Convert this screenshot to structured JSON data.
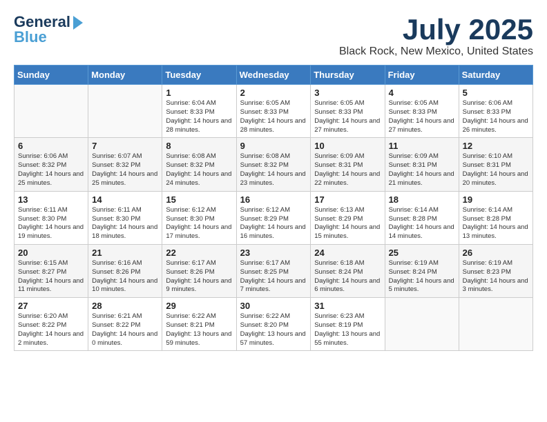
{
  "header": {
    "logo_line1": "General",
    "logo_line2": "Blue",
    "month_title": "July 2025",
    "location": "Black Rock, New Mexico, United States"
  },
  "weekdays": [
    "Sunday",
    "Monday",
    "Tuesday",
    "Wednesday",
    "Thursday",
    "Friday",
    "Saturday"
  ],
  "weeks": [
    [
      {
        "day": "",
        "info": ""
      },
      {
        "day": "",
        "info": ""
      },
      {
        "day": "1",
        "info": "Sunrise: 6:04 AM\nSunset: 8:33 PM\nDaylight: 14 hours and 28 minutes."
      },
      {
        "day": "2",
        "info": "Sunrise: 6:05 AM\nSunset: 8:33 PM\nDaylight: 14 hours and 28 minutes."
      },
      {
        "day": "3",
        "info": "Sunrise: 6:05 AM\nSunset: 8:33 PM\nDaylight: 14 hours and 27 minutes."
      },
      {
        "day": "4",
        "info": "Sunrise: 6:05 AM\nSunset: 8:33 PM\nDaylight: 14 hours and 27 minutes."
      },
      {
        "day": "5",
        "info": "Sunrise: 6:06 AM\nSunset: 8:33 PM\nDaylight: 14 hours and 26 minutes."
      }
    ],
    [
      {
        "day": "6",
        "info": "Sunrise: 6:06 AM\nSunset: 8:32 PM\nDaylight: 14 hours and 25 minutes."
      },
      {
        "day": "7",
        "info": "Sunrise: 6:07 AM\nSunset: 8:32 PM\nDaylight: 14 hours and 25 minutes."
      },
      {
        "day": "8",
        "info": "Sunrise: 6:08 AM\nSunset: 8:32 PM\nDaylight: 14 hours and 24 minutes."
      },
      {
        "day": "9",
        "info": "Sunrise: 6:08 AM\nSunset: 8:32 PM\nDaylight: 14 hours and 23 minutes."
      },
      {
        "day": "10",
        "info": "Sunrise: 6:09 AM\nSunset: 8:31 PM\nDaylight: 14 hours and 22 minutes."
      },
      {
        "day": "11",
        "info": "Sunrise: 6:09 AM\nSunset: 8:31 PM\nDaylight: 14 hours and 21 minutes."
      },
      {
        "day": "12",
        "info": "Sunrise: 6:10 AM\nSunset: 8:31 PM\nDaylight: 14 hours and 20 minutes."
      }
    ],
    [
      {
        "day": "13",
        "info": "Sunrise: 6:11 AM\nSunset: 8:30 PM\nDaylight: 14 hours and 19 minutes."
      },
      {
        "day": "14",
        "info": "Sunrise: 6:11 AM\nSunset: 8:30 PM\nDaylight: 14 hours and 18 minutes."
      },
      {
        "day": "15",
        "info": "Sunrise: 6:12 AM\nSunset: 8:30 PM\nDaylight: 14 hours and 17 minutes."
      },
      {
        "day": "16",
        "info": "Sunrise: 6:12 AM\nSunset: 8:29 PM\nDaylight: 14 hours and 16 minutes."
      },
      {
        "day": "17",
        "info": "Sunrise: 6:13 AM\nSunset: 8:29 PM\nDaylight: 14 hours and 15 minutes."
      },
      {
        "day": "18",
        "info": "Sunrise: 6:14 AM\nSunset: 8:28 PM\nDaylight: 14 hours and 14 minutes."
      },
      {
        "day": "19",
        "info": "Sunrise: 6:14 AM\nSunset: 8:28 PM\nDaylight: 14 hours and 13 minutes."
      }
    ],
    [
      {
        "day": "20",
        "info": "Sunrise: 6:15 AM\nSunset: 8:27 PM\nDaylight: 14 hours and 11 minutes."
      },
      {
        "day": "21",
        "info": "Sunrise: 6:16 AM\nSunset: 8:26 PM\nDaylight: 14 hours and 10 minutes."
      },
      {
        "day": "22",
        "info": "Sunrise: 6:17 AM\nSunset: 8:26 PM\nDaylight: 14 hours and 9 minutes."
      },
      {
        "day": "23",
        "info": "Sunrise: 6:17 AM\nSunset: 8:25 PM\nDaylight: 14 hours and 7 minutes."
      },
      {
        "day": "24",
        "info": "Sunrise: 6:18 AM\nSunset: 8:24 PM\nDaylight: 14 hours and 6 minutes."
      },
      {
        "day": "25",
        "info": "Sunrise: 6:19 AM\nSunset: 8:24 PM\nDaylight: 14 hours and 5 minutes."
      },
      {
        "day": "26",
        "info": "Sunrise: 6:19 AM\nSunset: 8:23 PM\nDaylight: 14 hours and 3 minutes."
      }
    ],
    [
      {
        "day": "27",
        "info": "Sunrise: 6:20 AM\nSunset: 8:22 PM\nDaylight: 14 hours and 2 minutes."
      },
      {
        "day": "28",
        "info": "Sunrise: 6:21 AM\nSunset: 8:22 PM\nDaylight: 14 hours and 0 minutes."
      },
      {
        "day": "29",
        "info": "Sunrise: 6:22 AM\nSunset: 8:21 PM\nDaylight: 13 hours and 59 minutes."
      },
      {
        "day": "30",
        "info": "Sunrise: 6:22 AM\nSunset: 8:20 PM\nDaylight: 13 hours and 57 minutes."
      },
      {
        "day": "31",
        "info": "Sunrise: 6:23 AM\nSunset: 8:19 PM\nDaylight: 13 hours and 55 minutes."
      },
      {
        "day": "",
        "info": ""
      },
      {
        "day": "",
        "info": ""
      }
    ]
  ]
}
